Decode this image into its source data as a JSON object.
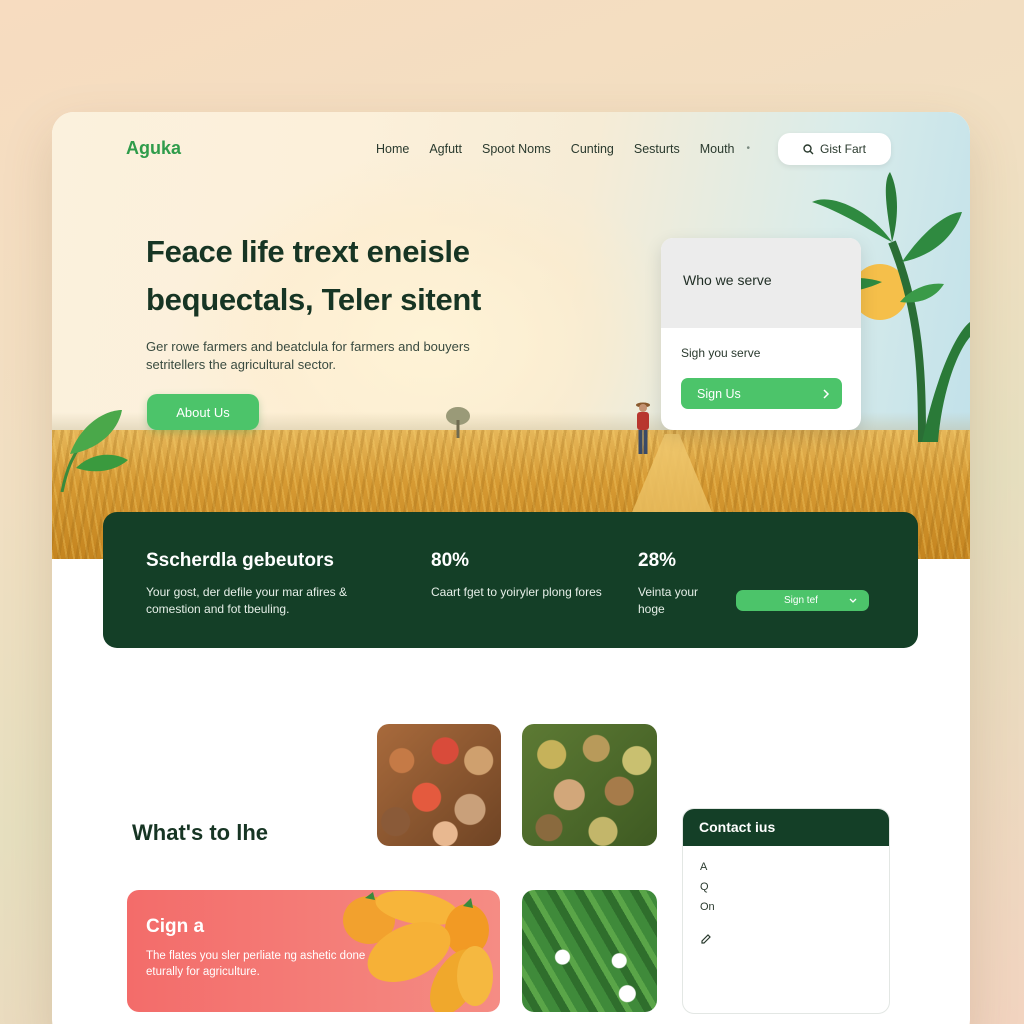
{
  "brand": {
    "logo": "Aguka",
    "accent": "#4cc46a",
    "dark": "#143f27"
  },
  "nav": {
    "items": [
      "Home",
      "Agfutt",
      "Spoot Noms",
      "Cunting",
      "Sesturts",
      "Mouth"
    ],
    "dot": "•",
    "cta_icon": "search-icon",
    "cta_label": "Gist Fart"
  },
  "hero": {
    "headline_line1": "Feace life trext eneisle",
    "headline_line2": "bequectals, Teler sitent",
    "subtext_line1": "Ger rowe farmers and beatclula for farmers and bouyers",
    "subtext_line2": "setritellers the agricultural sector.",
    "about_button": "About Us"
  },
  "serve_card": {
    "title": "Who we serve",
    "subtitle": "Sigh you serve",
    "button": "Sign Us",
    "button_icon": "chevron-right-icon"
  },
  "stats": {
    "title": "Sscherdla gebeutors",
    "desc": "Your gost, der defile your mar afires & comestion and fot tbeuling.",
    "stat2_value": "80%",
    "stat2_desc": "Caart fget to yoiryler plong fores",
    "stat3_value": "28%",
    "stat3_desc": "Veinta your hoge",
    "select_label": "Sign tef",
    "select_icon": "chevron-down-icon"
  },
  "section": {
    "title": "What's to lhe"
  },
  "promo": {
    "title": "Cign a",
    "text": "The flates you sler perliate ng ashetic done eturally for agriculture."
  },
  "contact": {
    "title": "Contact ius",
    "row1": "A",
    "row2": "Q",
    "row3": "On",
    "row4_icon": "pencil-icon"
  }
}
